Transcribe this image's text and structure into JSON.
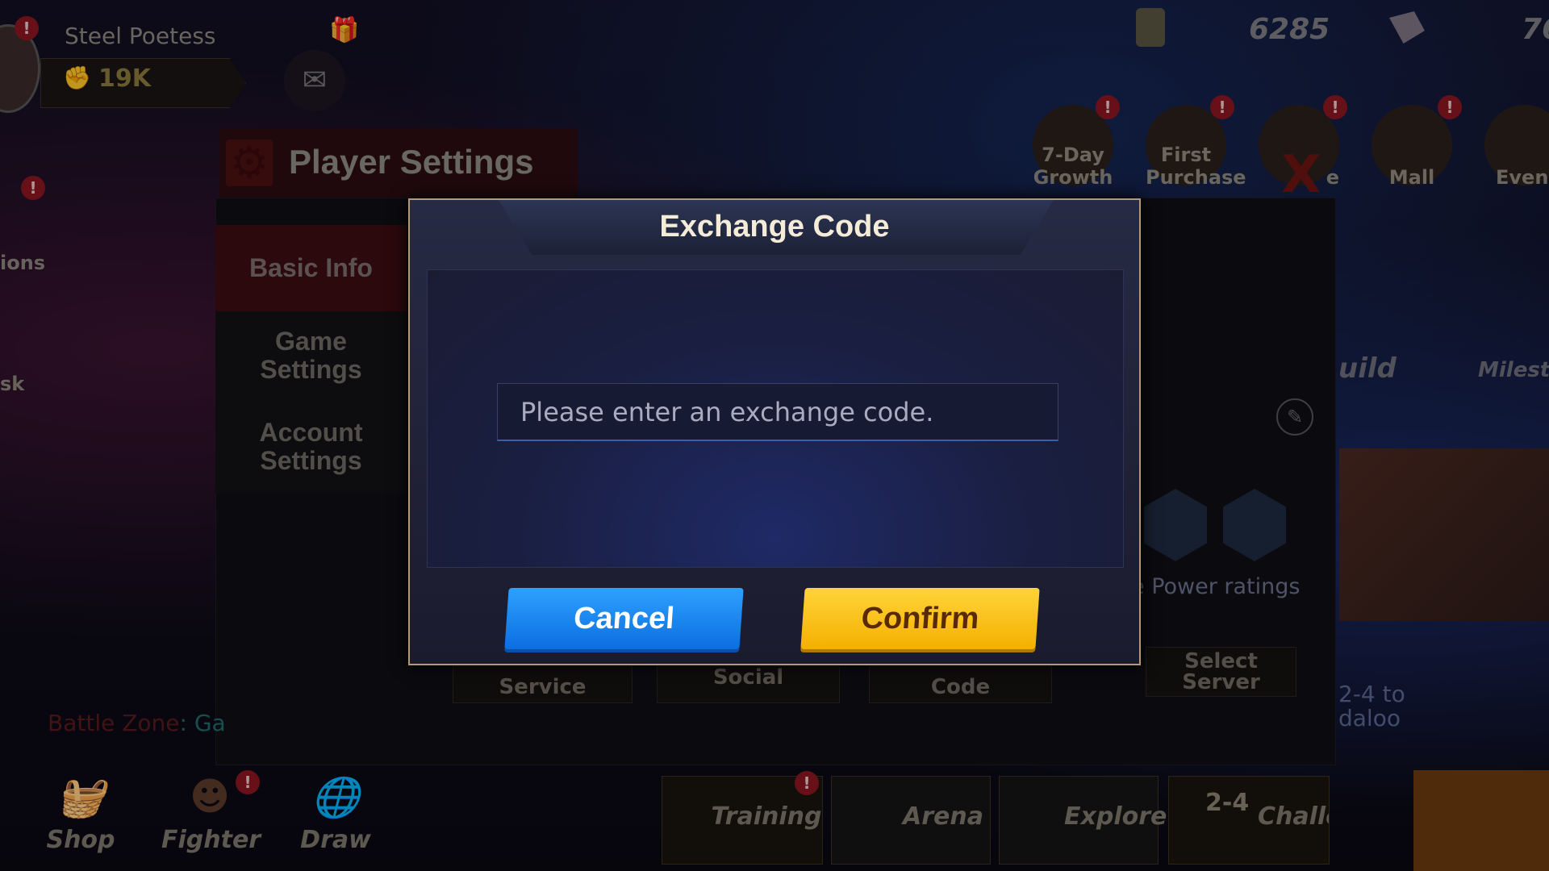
{
  "player": {
    "name": "Steel Poetess",
    "power": "19K"
  },
  "currency": {
    "gold": "6285",
    "gems": "76"
  },
  "top_icons": [
    {
      "label": "7-Day Growth"
    },
    {
      "label": "First Purchase"
    },
    {
      "label": "e"
    },
    {
      "label": "Mall"
    },
    {
      "label": "Even"
    }
  ],
  "settings": {
    "title": "Player Settings",
    "menu": [
      {
        "label": "Basic Info"
      },
      {
        "label": "Game Settings"
      },
      {
        "label": "Account Settings"
      }
    ],
    "tabs": [
      {
        "label": "Service"
      },
      {
        "label": "Social"
      },
      {
        "label": "Code"
      }
    ],
    "select_server": "Select Server",
    "power_ratings": "e Power ratings",
    "guild": "uild",
    "milestone": "Milest"
  },
  "side": {
    "ions": "ions",
    "sk": "sk",
    "stage": "2-4 to daloo"
  },
  "chat": {
    "zone": "Battle Zone",
    "text": ": Ga"
  },
  "bottom_nav": [
    {
      "label": "Shop"
    },
    {
      "label": "Fighter"
    },
    {
      "label": "Draw"
    },
    {
      "label": "Training"
    },
    {
      "label": "Arena"
    },
    {
      "label": "Explore"
    },
    {
      "label": "Challe"
    }
  ],
  "stage_badge": "2-4",
  "dialog": {
    "title": "Exchange Code",
    "placeholder": "Please enter an exchange code.",
    "value": "",
    "cancel": "Cancel",
    "confirm": "Confirm"
  },
  "colors": {
    "cancel": "#1a8cf5",
    "confirm": "#fcc51e",
    "alert": "#8a1620"
  }
}
